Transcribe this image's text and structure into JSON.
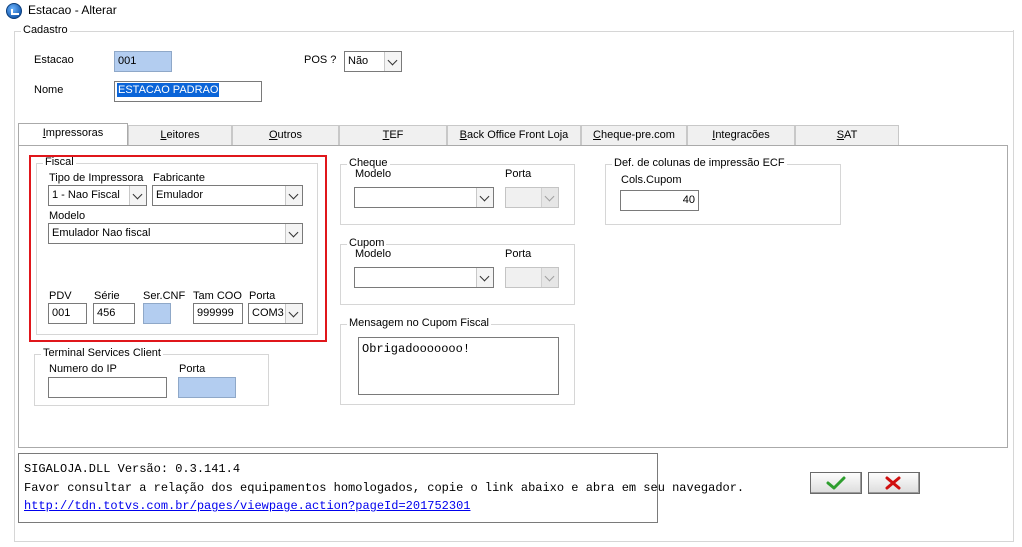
{
  "window": {
    "title": "Estacao - Alterar"
  },
  "cadastro": {
    "group_label": "Cadastro",
    "estacao_label": "Estacao",
    "estacao_value": "001",
    "pos_label": "POS ?",
    "pos_value": "Não",
    "nome_label": "Nome",
    "nome_value": "ESTACAO PADRAO"
  },
  "tabs": [
    {
      "label": "Impressoras",
      "active": true
    },
    {
      "label": "Leitores"
    },
    {
      "label": "Outros"
    },
    {
      "label": "TEF"
    },
    {
      "label": "Back Office Front Loja"
    },
    {
      "label": "Cheque-pre.com"
    },
    {
      "label": "Integracões"
    },
    {
      "label": "SAT"
    }
  ],
  "fiscal": {
    "group_label": "Fiscal",
    "tipo_label": "Tipo de Impressora",
    "tipo_value": "1 - Nao Fiscal",
    "fabricante_label": "Fabricante",
    "fabricante_value": "Emulador",
    "modelo_label": "Modelo",
    "modelo_value": "Emulador Nao fiscal",
    "pdv_label": "PDV",
    "pdv_value": "001",
    "serie_label": "Série",
    "serie_value": "456",
    "sercnf_label": "Ser.CNF",
    "sercnf_value": "",
    "tamcoo_label": "Tam COO",
    "tamcoo_value": "999999",
    "porta_label": "Porta",
    "porta_value": "COM3"
  },
  "terminal": {
    "group_label": "Terminal Services Client",
    "ip_label": "Numero do IP",
    "ip_value": "",
    "porta_label": "Porta",
    "porta_value": ""
  },
  "cheque": {
    "group_label": "Cheque",
    "modelo_label": "Modelo",
    "modelo_value": "",
    "porta_label": "Porta",
    "porta_value": ""
  },
  "cupom": {
    "group_label": "Cupom",
    "modelo_label": "Modelo",
    "modelo_value": "",
    "porta_label": "Porta",
    "porta_value": ""
  },
  "mensagem": {
    "group_label": "Mensagem no Cupom Fiscal",
    "value": "Obrigadooooooo!"
  },
  "ecf": {
    "group_label": "Def. de colunas de impressão ECF",
    "cols_label": "Cols.Cupom",
    "cols_value": "40"
  },
  "info": {
    "line1": "SIGALOJA.DLL Versão: 0.3.141.4",
    "line2": "Favor consultar a relação dos equipamentos homologados, copie o link abaixo e abra em seu navegador.",
    "link": "http://tdn.totvs.com.br/pages/viewpage.action?pageId=201752301"
  },
  "buttons": {
    "confirm_icon": "check-icon",
    "cancel_icon": "x-icon",
    "confirm_color": "#2e9e2e",
    "cancel_color": "#d01010"
  }
}
